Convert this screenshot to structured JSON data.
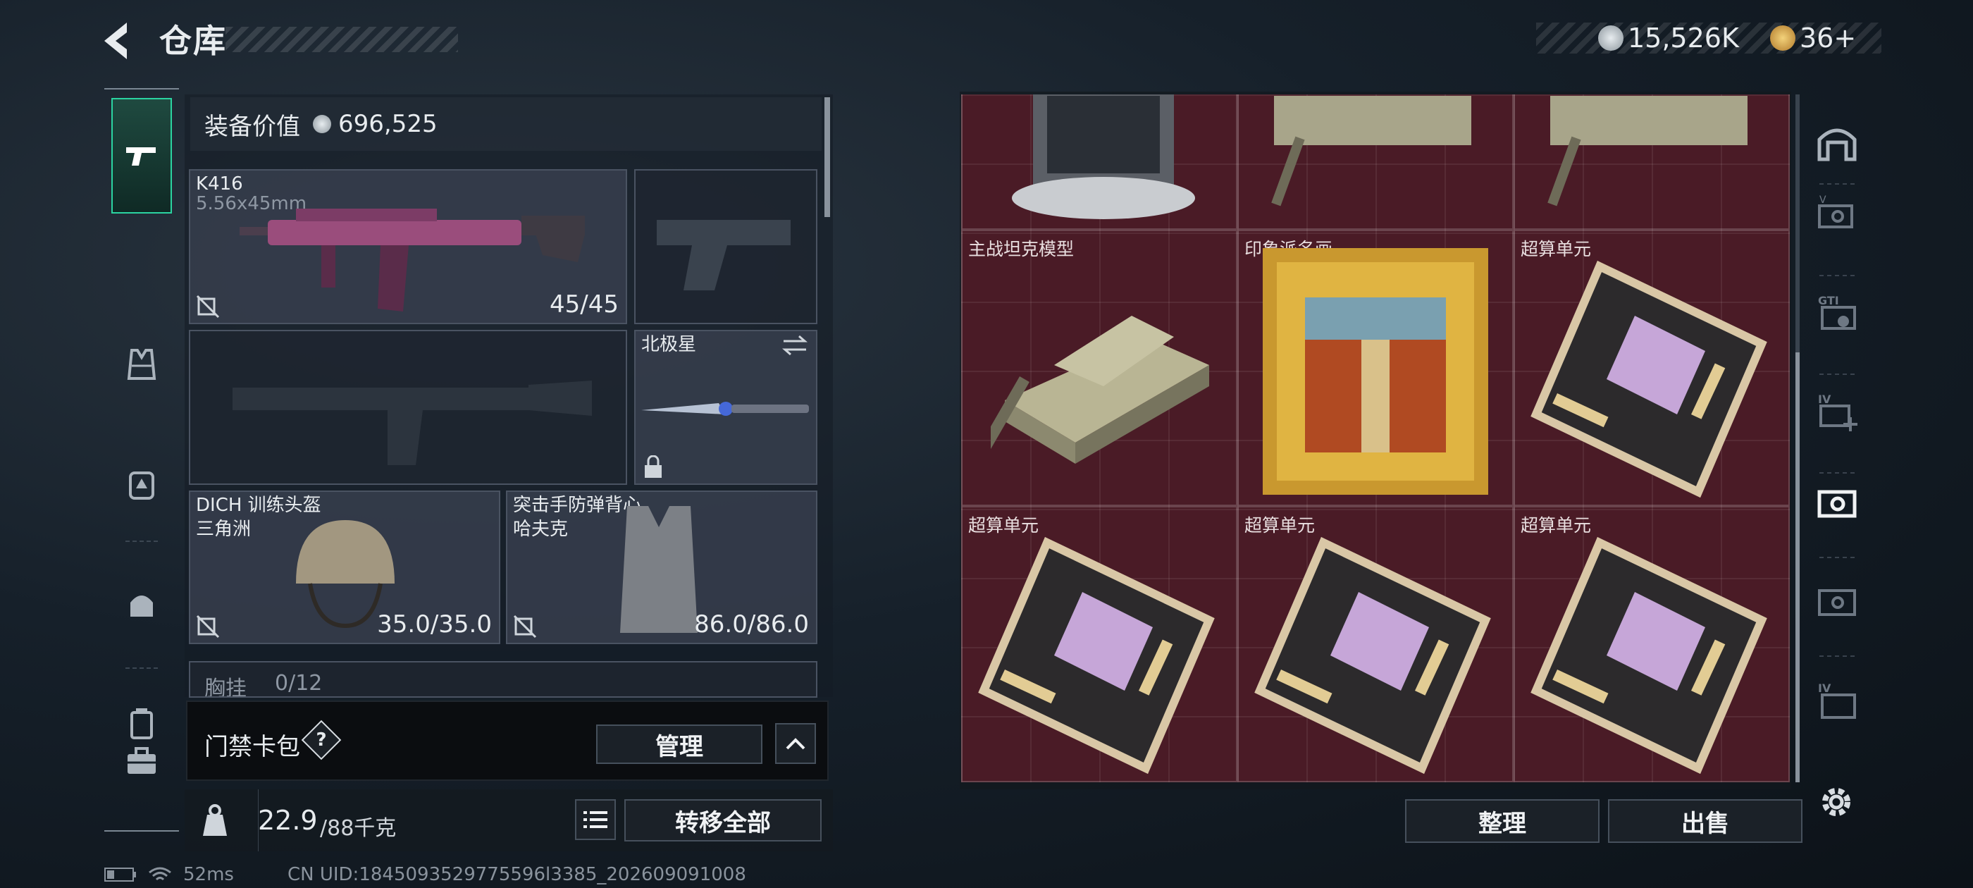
{
  "header": {
    "title": "仓库",
    "currencies": [
      {
        "icon": "silver-coin-icon",
        "value": "15,526K"
      },
      {
        "icon": "gold-coin-icon",
        "value": "36+"
      }
    ]
  },
  "left_nav": {
    "items": [
      {
        "icon": "pistol-icon",
        "active": true
      },
      {
        "icon": "vest-icon"
      },
      {
        "icon": "backpack-icon"
      },
      {
        "icon": "helmet-bag-icon"
      },
      {
        "icon": "canister-icon"
      },
      {
        "icon": "briefcase-icon"
      }
    ]
  },
  "equipment": {
    "value_label": "装备价值",
    "value": "696,525",
    "primary_weapon": {
      "name": "K416",
      "ammo": "5.56x45mm",
      "count": "45/45"
    },
    "sidearm": {
      "name": ""
    },
    "secondary_weapon": {
      "name": ""
    },
    "melee": {
      "name": "北极星"
    },
    "helmet": {
      "name": "DICH 训练头盔",
      "brand": "三角洲",
      "durability": "35.0/35.0"
    },
    "armor": {
      "name": "突击手防弹背心",
      "brand": "哈夫克",
      "durability": "86.0/86.0"
    },
    "chest_rig": {
      "label": "胸挂",
      "capacity": "0/12"
    }
  },
  "access_pack": {
    "label": "门禁卡包",
    "help": "?",
    "manage_button": "管理",
    "collapse_icon": "chevron-up-icon"
  },
  "weight": {
    "current": "22.9",
    "max": "/88千克",
    "transfer_all_button": "转移全部",
    "list_icon": "list-icon"
  },
  "storage": {
    "top_row": [
      {
        "label": "",
        "icon": "reactor-tower-icon"
      },
      {
        "label": "",
        "icon": "tank-icon"
      },
      {
        "label": "",
        "icon": "tank-icon"
      }
    ],
    "row2": [
      {
        "label": "主战坦克模型",
        "icon": "tank-icon"
      },
      {
        "label": "印象派名画",
        "icon": "painting-icon"
      },
      {
        "label": "超算单元",
        "icon": "computing-unit-icon"
      }
    ],
    "row3": [
      {
        "label": "超算单元",
        "icon": "computing-unit-icon"
      },
      {
        "label": "超算单元",
        "icon": "computing-unit-icon"
      },
      {
        "label": "超算单元",
        "icon": "computing-unit-icon"
      }
    ],
    "sort_button": "整理",
    "sell_button": "出售"
  },
  "right_tabs": {
    "items": [
      {
        "icon": "safehouse-icon",
        "label": ""
      },
      {
        "icon": "storage-tab-icon",
        "label": "V"
      },
      {
        "icon": "storage-tab-icon",
        "label": "GTI"
      },
      {
        "icon": "storage-add-icon",
        "label": "IV"
      },
      {
        "icon": "storage-tab-icon",
        "label": "",
        "active": true
      },
      {
        "icon": "storage-tab-icon",
        "label": ""
      },
      {
        "icon": "storage-tab-icon",
        "label": "IV"
      }
    ],
    "settings_icon": "gear-icon"
  },
  "status": {
    "ping": "52ms",
    "uid": "CN UID:1845093529775596l3385_202609091008"
  },
  "colors": {
    "accent": "#2bd4a1",
    "storage_bg": "#4a1b26",
    "panel": "#1b2128"
  }
}
